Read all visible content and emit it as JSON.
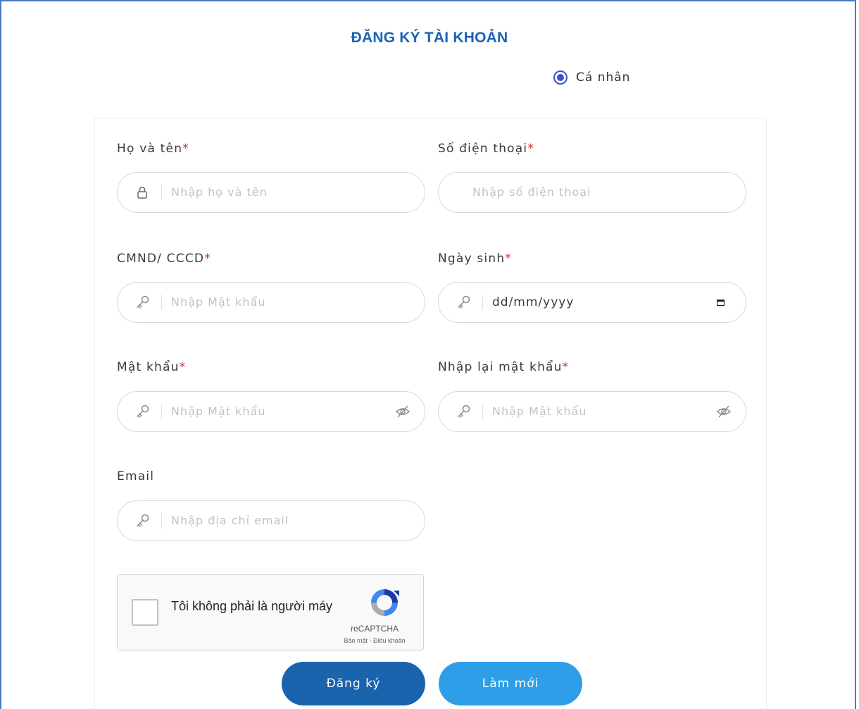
{
  "page": {
    "title": "ĐĂNG KÝ TÀI KHOẢN",
    "account_type": {
      "label": "Cá nhân",
      "selected": true
    }
  },
  "form": {
    "required_mark": "*",
    "full_name": {
      "label": "Họ và tên",
      "placeholder": "Nhập họ và tên",
      "icon": "lock-icon"
    },
    "phone": {
      "label": "Số điện thoại",
      "placeholder": "Nhập số điện thoại"
    },
    "id_number": {
      "label": "CMND/ CCCD",
      "placeholder": "Nhập Mật khẩu",
      "icon": "key-icon"
    },
    "birthday": {
      "label": "Ngày sinh",
      "value": "dd/mm/yyyy",
      "icon": "key-icon",
      "trailing_icon": "calendar-icon"
    },
    "password": {
      "label": "Mật khẩu",
      "placeholder": "Nhập Mật khẩu",
      "icon": "key-icon",
      "trailing_icon": "eye-slash-icon"
    },
    "confirm_password": {
      "label": "Nhập lại mật khẩu",
      "placeholder": "Nhập Mật khẩu",
      "icon": "key-icon",
      "trailing_icon": "eye-slash-icon"
    },
    "email": {
      "label": "Email",
      "placeholder": "Nhập địa chỉ email",
      "icon": "key-icon"
    }
  },
  "captcha": {
    "label": "Tôi không phải là người máy",
    "brand": "reCAPTCHA",
    "links": "Bảo mật - Điều khoản"
  },
  "buttons": {
    "submit": "Đăng ký",
    "reset": "Làm mới"
  },
  "colors": {
    "title": "#1a64b4",
    "required": "#e0262c",
    "primary_button": "#1a63ad",
    "secondary_button": "#2e9ee8",
    "radio": "#3d52c8"
  }
}
